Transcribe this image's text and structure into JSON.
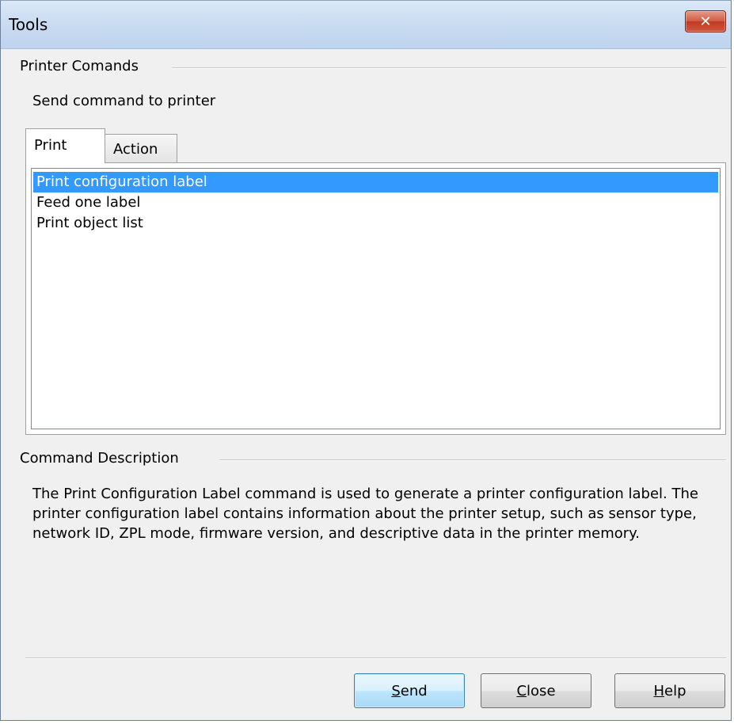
{
  "window": {
    "title": "Tools",
    "close_glyph": "✕"
  },
  "printer_commands": {
    "group_title": "Printer Comands",
    "subtitle": "Send command to printer",
    "tabs": [
      {
        "label": "Print",
        "active": true
      },
      {
        "label": "Action",
        "active": false
      }
    ],
    "list_items": [
      {
        "label": "Print configuration label",
        "selected": true
      },
      {
        "label": "Feed one label",
        "selected": false
      },
      {
        "label": "Print object list",
        "selected": false
      }
    ]
  },
  "command_description": {
    "group_title": "Command Description",
    "text": "The Print Configuration Label command is used to generate a printer configuration label. The printer configuration label contains information about the printer setup, such as sensor type, network ID, ZPL mode, firmware version, and descriptive data in the printer memory."
  },
  "buttons": {
    "send": {
      "accel": "S",
      "rest": "end"
    },
    "close": {
      "accel": "C",
      "rest": "lose"
    },
    "help": {
      "accel": "H",
      "rest": "elp"
    }
  },
  "colors": {
    "selection": "#3399ff",
    "titlebar": "#c6d9f0",
    "close_button": "#c03a22"
  }
}
